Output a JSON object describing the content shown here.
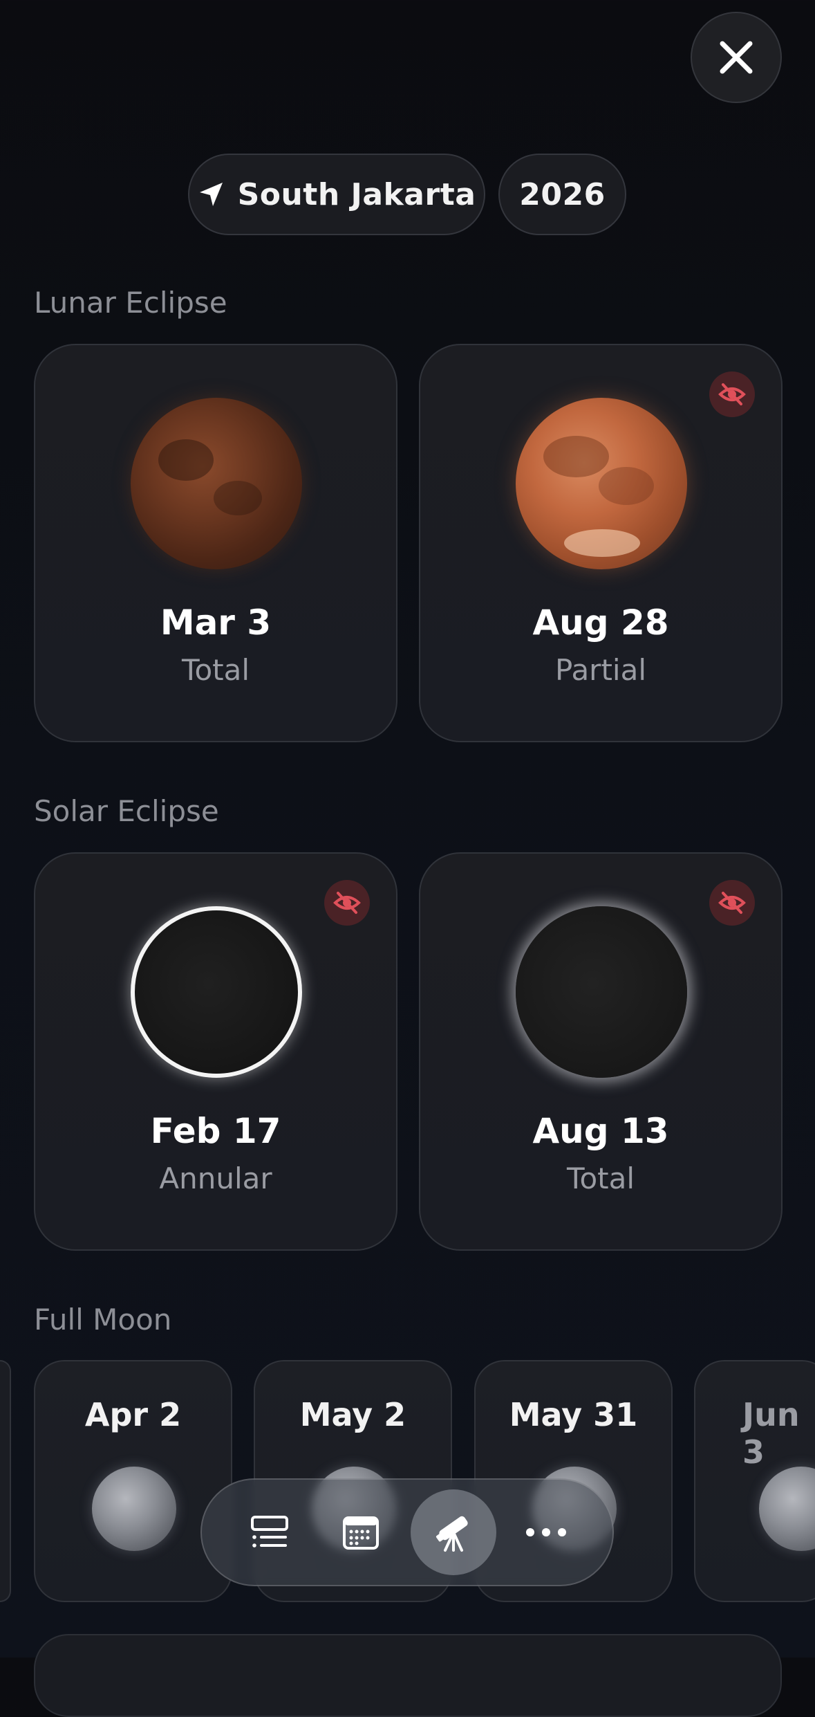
{
  "header": {
    "close_icon": "close-icon",
    "location": "South Jakarta",
    "location_icon": "location-arrow-icon",
    "year": "2026"
  },
  "lunar": {
    "title": "Lunar Eclipse",
    "items": [
      {
        "date": "Mar 3",
        "kind": "Total",
        "hidden": false
      },
      {
        "date": "Aug 28",
        "kind": "Partial",
        "hidden": true
      }
    ]
  },
  "solar": {
    "title": "Solar Eclipse",
    "items": [
      {
        "date": "Feb 17",
        "kind": "Annular",
        "hidden": true
      },
      {
        "date": "Aug 13",
        "kind": "Total",
        "hidden": true
      }
    ]
  },
  "full_moon": {
    "title": "Full Moon",
    "items": [
      {
        "date": "Apr 2"
      },
      {
        "date": "May 2"
      },
      {
        "date": "May 31"
      },
      {
        "date": "Jun 3"
      }
    ]
  },
  "tabbar": {
    "items": [
      {
        "icon": "list-icon",
        "active": false
      },
      {
        "icon": "calendar-icon",
        "active": false
      },
      {
        "icon": "telescope-icon",
        "active": true
      },
      {
        "icon": "more-icon",
        "active": false
      }
    ]
  },
  "colors": {
    "background": "#0b0c10",
    "card": "#1c1d22",
    "hidden_badge": "#4a2226",
    "hidden_icon": "#e0505a",
    "secondary_text": "#9a9ca3"
  }
}
